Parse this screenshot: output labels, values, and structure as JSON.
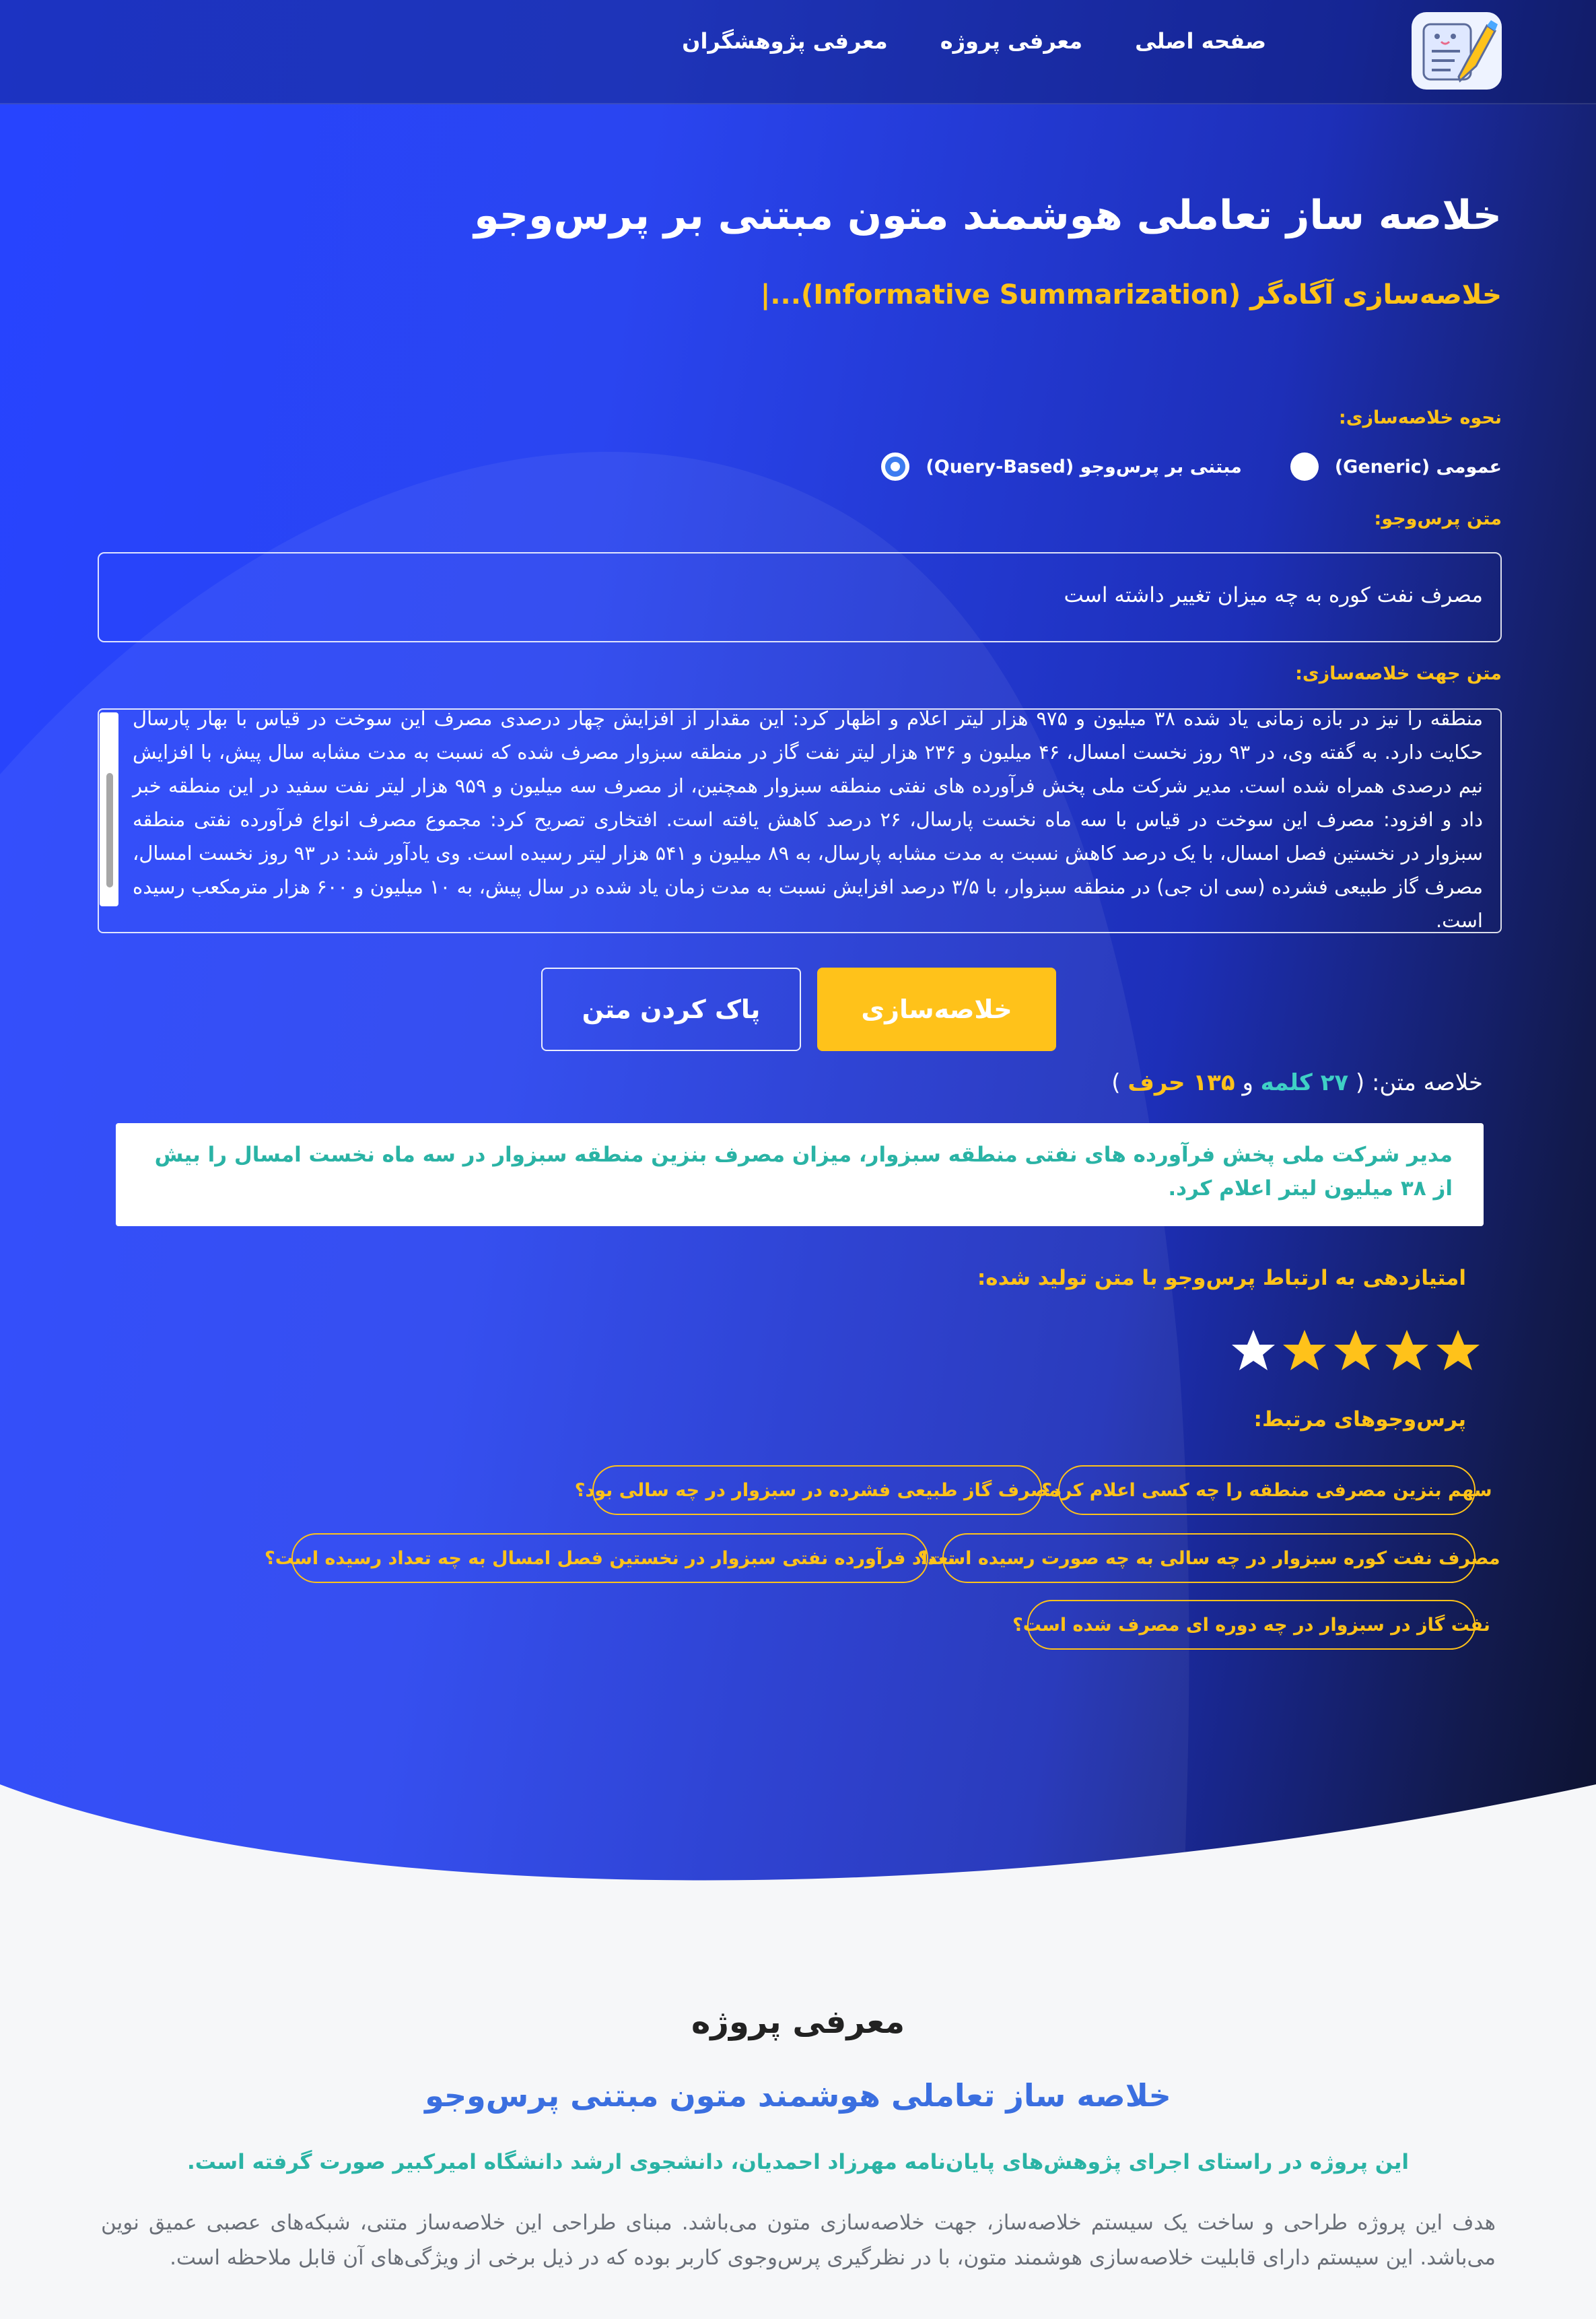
{
  "nav": {
    "links": [
      "صفحه اصلی",
      "معرفی پروژه",
      "معرفی پژوهشگران"
    ]
  },
  "hero": {
    "title": "خلاصه ساز تعاملی هوشمند متون مبتنی بر پرس‌وجو",
    "subtitle": "خلاصه‌سازی آگاه‌گر (Informative Summarization)...|"
  },
  "form": {
    "mode_label": "نحوه خلاصه‌سازی:",
    "mode_generic": "عمومی (Generic)",
    "mode_query": "مبتنی بر پرس‌وجو (Query-Based)",
    "mode_selected": "query",
    "query_label": "متن پرس‌وجو:",
    "query_value": "مصرف نفت کوره به چه میزان تغییر داشته است",
    "text_label": "متن جهت خلاصه‌سازی:",
    "text_value": "منطقه را نیز در بازه زمانی یاد شده ۳۸ میلیون و ۹۷۵ هزار لیتر اعلام و اظهار کرد: این مقدار از افزایش چهار درصدی مصرف این سوخت در قیاس با بهار پارسال حکایت دارد. به گفته وی، در ۹۳ روز نخست امسال، ۴۶ میلیون و ۲۳۶ هزار لیتر نفت گاز در منطقه سبزوار مصرف شده که نسبت به مدت مشابه سال پیش، با افزایش نیم درصدی همراه شده است. مدیر شرکت ملی پخش فرآورده های نفتی منطقه سبزوار همچنین، از مصرف سه میلیون و ۹۵۹ هزار لیتر نفت سفید در این منطقه خبر داد و افزود: مصرف این سوخت در قیاس با سه ماه نخست پارسال، ۲۶ درصد کاهش یافته است. افتخاری تصریح کرد: مجموع مصرف انواع فرآورده نفتی منطقه سبزوار در نخستین فصل امسال، با یک درصد کاهش نسبت به مدت مشابه پارسال، به ۸۹ میلیون و ۵۴۱ هزار لیتر رسیده است. وی یادآور شد: در ۹۳ روز نخست امسال، مصرف گاز طبیعی فشرده (سی ان جی) در منطقه سبزوار، با ۳/۵ درصد افزایش نسبت به مدت زمان یاد شده در سال پیش، به ۱۰ میلیون و ۶۰۰ هزار مترمکعب رسیده است.",
    "summarize_button": "خلاصه‌سازی",
    "clear_button": "پاک کردن متن"
  },
  "summary": {
    "prefix": "خلاصه متن: (",
    "words": "۲۷ کلمه",
    "and": "و",
    "chars": "۱۳۵ حرف",
    "suffix": ")",
    "text": "مدیر شرکت ملی پخش فرآورده های نفتی منطقه سبزوار، میزان مصرف بنزین منطقه سبزوار در سه ماه نخست امسال را بیش از ۳۸ میلیون لیتر اعلام کرد."
  },
  "rating": {
    "label": "امتیازدهی به ارتباط پرس‌وجو با متن تولید شده:",
    "value": 4,
    "max": 5,
    "filled_color": "#ffc21a",
    "empty_color": "#ffffff"
  },
  "related": {
    "label": "پرس‌وجوهای مرتبط:",
    "items": [
      "سهم بنزین مصرفی منطقه را چه کسی اعلام کرد؟",
      "مصرف گاز طبیعی فشرده در سبزوار در چه سالی بود؟",
      "مصرف نفت کوره سبزوار در چه سالی به چه صورت رسیده است؟",
      "تعداد فرآورده نفتی سبزوار در نخستین فصل امسال به چه تعداد رسیده است؟",
      "نفت گاز در سبزوار در چه دوره ای مصرف شده است؟"
    ]
  },
  "intro": {
    "title": "معرفی پروژه",
    "subtitle": "خلاصه ساز تعاملی هوشمند متون مبتنی پرس‌وجو",
    "note": "این پروژه در راستای اجرای پژوهش‌های پایان‌نامه مهرزاد احمدیان، دانشجوی ارشد دانشگاه امیرکبیر صورت گرفته است.",
    "body": "هدف این پروژه طراحی و ساخت یک سیستم خلاصه‌ساز، جهت خلاصه‌سازی متون می‌باشد. مبنای طراحی این خلاصه‌ساز متنی، شبکه‌های عصبی عمیق نوین می‌باشد. این سیستم دارای قابلیت خلاصه‌سازی هوشمند متون، با در نظرگیری پرس‌وجوی کاربر بوده که در ذیل برخی از ویژگی‌های آن قابل ملاحظه است."
  },
  "colors": {
    "accent": "#ffc21a",
    "primary_blue": "#2744ff",
    "teal": "#2ab3a5",
    "link_blue": "#3b6fe0"
  }
}
